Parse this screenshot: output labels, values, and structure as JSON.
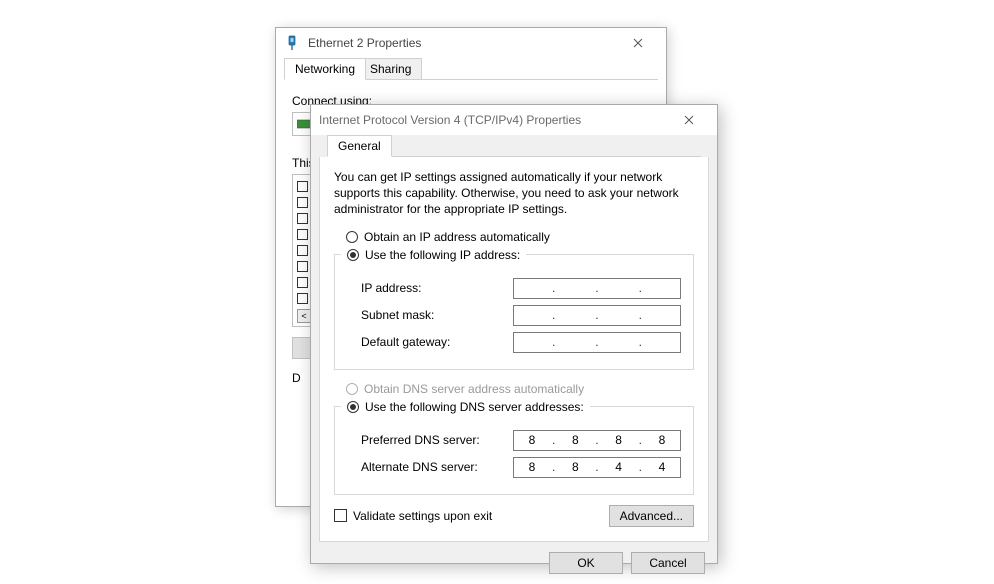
{
  "back_window": {
    "title": "Ethernet 2 Properties",
    "tabs": {
      "networking": "Networking",
      "sharing": "Sharing"
    },
    "connect_using_label": "Connect using:",
    "this_uses_label": "This connection uses the following items:",
    "desc_prefix": "D"
  },
  "front_window": {
    "title": "Internet Protocol Version 4 (TCP/IPv4) Properties",
    "tab_general": "General",
    "intro": "You can get IP settings assigned automatically if your network supports this capability. Otherwise, you need to ask your network administrator for the appropriate IP settings.",
    "ip_section": {
      "auto_label": "Obtain an IP address automatically",
      "manual_label": "Use the following IP address:",
      "ip_label": "IP address:",
      "subnet_label": "Subnet mask:",
      "gateway_label": "Default gateway:",
      "ip_value": [
        "",
        "",
        "",
        ""
      ],
      "subnet_value": [
        "",
        "",
        "",
        ""
      ],
      "gateway_value": [
        "",
        "",
        "",
        ""
      ]
    },
    "dns_section": {
      "auto_label": "Obtain DNS server address automatically",
      "manual_label": "Use the following DNS server addresses:",
      "preferred_label": "Preferred DNS server:",
      "alternate_label": "Alternate DNS server:",
      "preferred_value": [
        "8",
        "8",
        "8",
        "8"
      ],
      "alternate_value": [
        "8",
        "8",
        "4",
        "4"
      ]
    },
    "validate_label": "Validate settings upon exit",
    "advanced_button": "Advanced...",
    "ok_button": "OK",
    "cancel_button": "Cancel"
  }
}
